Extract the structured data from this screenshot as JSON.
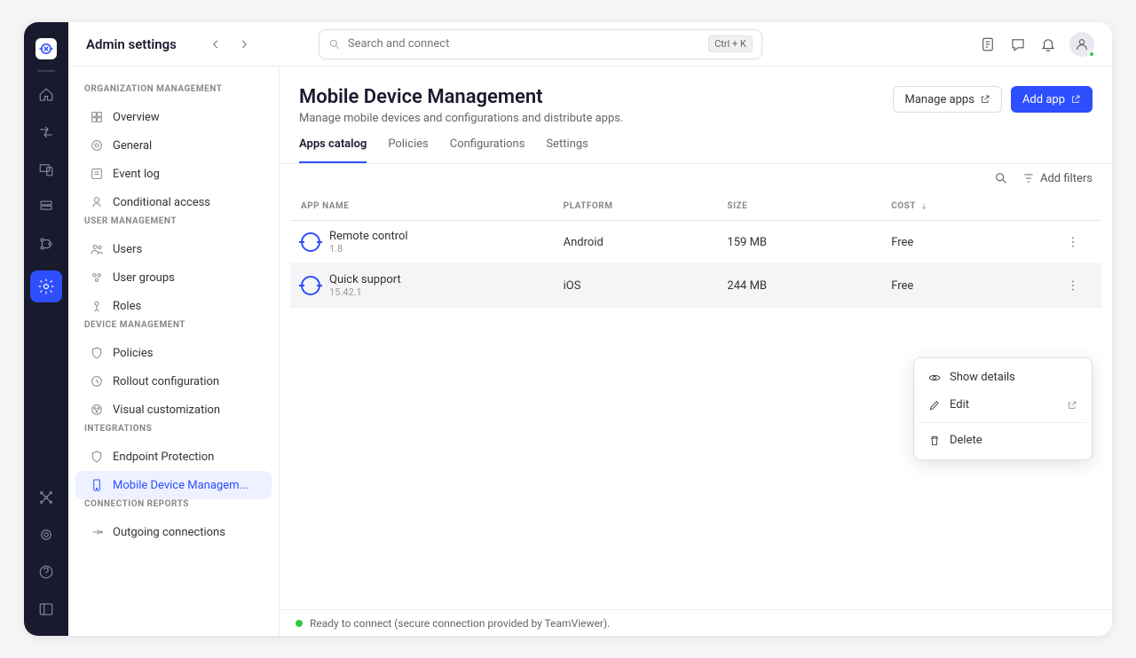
{
  "topbar": {
    "title": "Admin settings",
    "search_placeholder": "Search and connect",
    "shortcut": "Ctrl + K"
  },
  "sidebar": {
    "sections": [
      {
        "head": "ORGANIZATION MANAGEMENT",
        "items": [
          "Overview",
          "General",
          "Event log",
          "Conditional access"
        ]
      },
      {
        "head": "USER MANAGEMENT",
        "items": [
          "Users",
          "User groups",
          "Roles"
        ]
      },
      {
        "head": "DEVICE MANAGEMENT",
        "items": [
          "Policies",
          "Rollout configuration",
          "Visual customization"
        ]
      },
      {
        "head": "INTEGRATIONS",
        "items": [
          "Endpoint Protection",
          "Mobile Device Managem..."
        ]
      },
      {
        "head": "CONNECTION REPORTS",
        "items": [
          "Outgoing connections"
        ]
      }
    ]
  },
  "page": {
    "title": "Mobile Device Management",
    "subtitle": "Manage mobile devices and configurations and distribute apps.",
    "manage_apps": "Manage apps",
    "add_app": "Add app",
    "tabs": [
      "Apps catalog",
      "Policies",
      "Configurations",
      "Settings"
    ],
    "add_filters": "Add filters",
    "columns": [
      "APP NAME",
      "PLATFORM",
      "SIZE",
      "COST"
    ],
    "rows": [
      {
        "name": "Remote control",
        "ver": "1.8",
        "platform": "Android",
        "size": "159 MB",
        "cost": "Free"
      },
      {
        "name": "Quick support",
        "ver": "15.42.1",
        "platform": "iOS",
        "size": "244 MB",
        "cost": "Free"
      }
    ],
    "context_menu": {
      "show_details": "Show details",
      "edit": "Edit",
      "delete": "Delete"
    }
  },
  "status": "Ready to connect (secure connection provided by TeamViewer)."
}
